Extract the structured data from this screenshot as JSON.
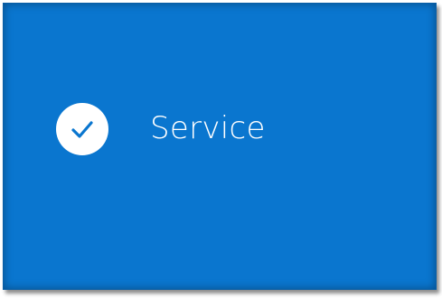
{
  "tile": {
    "label": "Service",
    "icon": "check-circle-icon",
    "background_color": "#0a76cf",
    "icon_color": "#0a76cf",
    "text_color": "#ffffff"
  }
}
